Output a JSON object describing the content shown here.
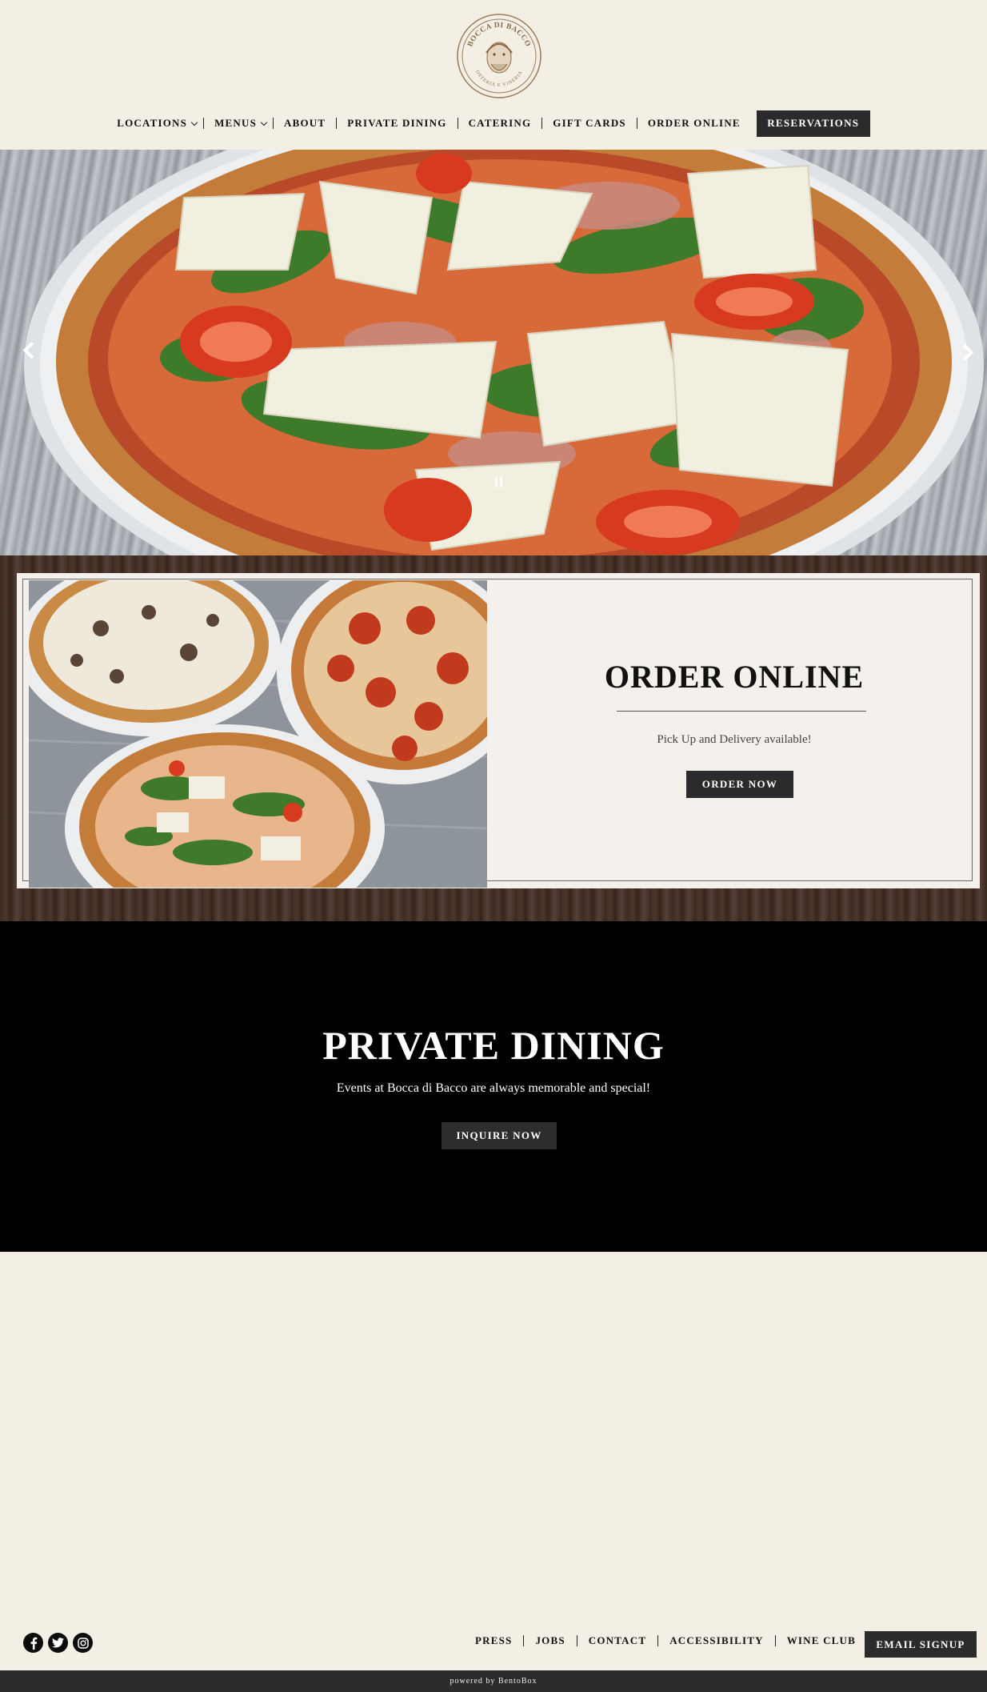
{
  "logo": {
    "top_text": "BOCCA DI BACCO",
    "bottom_text": "OSTERIA E VINERIA"
  },
  "nav": {
    "items": [
      {
        "label": "LOCATIONS",
        "dropdown": true
      },
      {
        "label": "MENUS",
        "dropdown": true
      },
      {
        "label": "ABOUT",
        "dropdown": false
      },
      {
        "label": "PRIVATE DINING",
        "dropdown": false
      },
      {
        "label": "CATERING",
        "dropdown": false
      },
      {
        "label": "GIFT CARDS",
        "dropdown": false
      },
      {
        "label": "ORDER ONLINE",
        "dropdown": false
      }
    ],
    "reservations_label": "RESERVATIONS"
  },
  "hero": {
    "prev_icon": "chevron-left-icon",
    "next_icon": "chevron-right-icon",
    "pause_icon": "pause-icon"
  },
  "order_online": {
    "title": "ORDER ONLINE",
    "subtitle": "Pick Up and Delivery available!",
    "button_label": "ORDER NOW"
  },
  "private_dining": {
    "title": "PRIVATE DINING",
    "subtitle": "Events at Bocca di Bacco are always memorable and special!",
    "button_label": "INQUIRE NOW"
  },
  "footer": {
    "social": [
      "facebook-icon",
      "twitter-icon",
      "instagram-icon"
    ],
    "links": [
      "PRESS",
      "JOBS",
      "CONTACT",
      "ACCESSIBILITY",
      "WINE CLUB"
    ],
    "email_signup_label": "EMAIL SIGNUP",
    "powered_by": "powered by BentoBox"
  },
  "colors": {
    "background": "#f3efe4",
    "button_dark": "#2b2b2e",
    "private_bg": "#000000"
  }
}
